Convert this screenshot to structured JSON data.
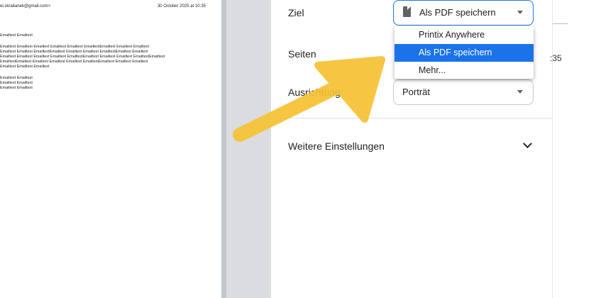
{
  "preview": {
    "from": "el.skrabanek@gmail.com>",
    "date": "30 October 2025 at 10:35",
    "paragraphs": [
      [
        "Emailtext  Emailtext"
      ],
      [
        "Emailtext  Emailtext Emailtext Emailtext Emailtext  EmailtextEmailtext Emailtext Emailtext",
        "Emailtext Emailtext  EmailtextEmailtext Emailtext Emailtext  EmailtextEmailtext Emailtext",
        "Emailtext Emailtext Emailtext  Emailtext EmailtextEmailtext Emailtext Emailtext  EmailtextEmailtext",
        "EmailtextEmailtext Emailtext Emailtext Emailtext  EmailtextEmailtext Emailtext Emailtext",
        "Emailtext Emailtext  Emailtext"
      ],
      [
        "Emailtext  Emailtext",
        "Emailtext  Emailtext",
        "Emailtext  Emailtext"
      ]
    ]
  },
  "settings": {
    "destination_label": "Ziel",
    "destination_value": "Als PDF speichern",
    "pages_label": "Seiten",
    "orientation_label": "Ausrichtung",
    "orientation_value": "Porträt",
    "more_settings_label": "Weitere Einstellungen",
    "dropdown_options": [
      "Printix Anywhere",
      "Als PDF speichern",
      "Mehr..."
    ],
    "dropdown_selected_index": 1
  },
  "peek": {
    "time_fragment": ":35"
  },
  "colors": {
    "accent": "#1a73e8",
    "arrow": "#f6c233"
  }
}
